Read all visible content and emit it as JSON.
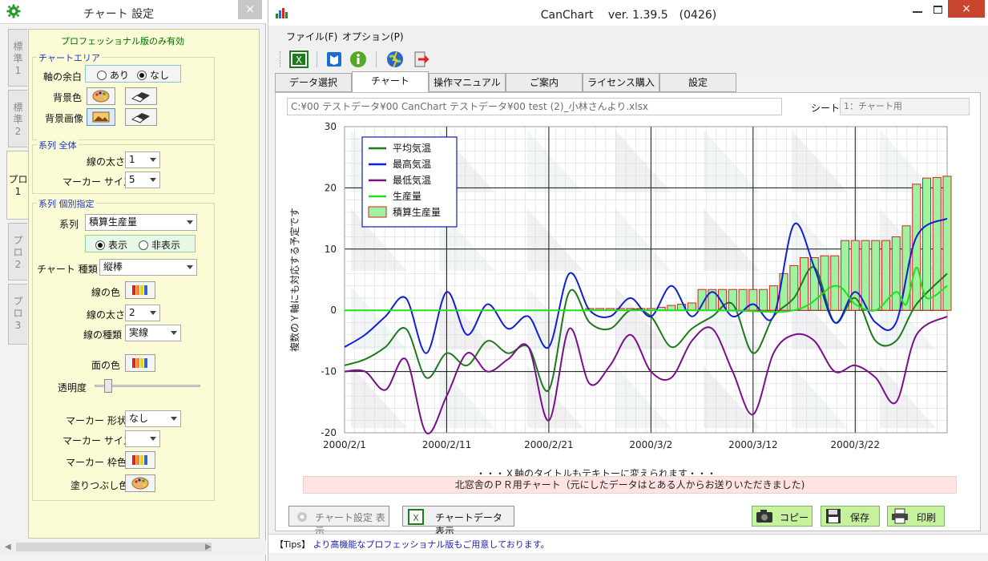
{
  "settings_window": {
    "title": "チャート 設定",
    "close_label": "×",
    "side_tabs": [
      {
        "label": "標準\n1"
      },
      {
        "label": "標準\n2"
      },
      {
        "label": "プロ\n1"
      },
      {
        "label": "プロ\n2"
      },
      {
        "label": "プロ\n3"
      }
    ],
    "active_tab": "プロ\n1",
    "pro_note": "プロフェッショナル版のみ有効",
    "chart_area": {
      "title": "チャートエリア",
      "margin_label": "軸の余白",
      "margin_options": [
        "あり",
        "なし"
      ],
      "margin_selected": "なし",
      "bg_color_label": "背景色",
      "bg_image_label": "背景画像"
    },
    "series_all": {
      "title": "系列 全体",
      "line_width_label": "線の太さ",
      "line_width_value": "1",
      "marker_size_label": "マーカー サイズ",
      "marker_size_value": "5"
    },
    "series_each": {
      "title": "系列 個別指定",
      "series_label": "系列",
      "series_value": "積算生産量",
      "visibility_options": [
        "表示",
        "非表示"
      ],
      "visibility_selected": "表示",
      "chart_type_label": "チャート 種類",
      "chart_type_value": "縦棒",
      "line_color_label": "線の色",
      "line_width_label": "線の太さ",
      "line_width_value": "2",
      "line_style_label": "線の種類",
      "line_style_value": "実線",
      "fill_color_label": "面の色",
      "opacity_label": "透明度",
      "opacity_value": 0.1,
      "marker_shape_label": "マーカー 形状",
      "marker_shape_value": "なし",
      "marker_size_label": "マーカー サイズ",
      "marker_size_value": "",
      "marker_border_label": "マーカー 枠色",
      "fill_label": "塗りつぶし色"
    }
  },
  "main_window": {
    "title": "CanChart　 ver. 1.39.5　(0426)",
    "close_label": "×",
    "menu": [
      "ファイル(F)",
      "オプション(P)"
    ],
    "toolbar_icons": [
      "excel-icon",
      "manual-book-icon",
      "info-icon",
      "update-globe-icon",
      "exit-icon"
    ],
    "tabs": [
      "データ選択",
      "チャート",
      "操作マニュアル",
      "ご案内",
      "ライセンス購入",
      "設定"
    ],
    "active_tab": "チャート",
    "file_path": "C:¥00 テストデータ¥00 CanChart テストデータ¥00 test (2)_小林さんより.xlsx",
    "sheet_label": "シート",
    "sheet_value": "1：チャート用",
    "x_title": "・・・Ｘ軸のタイトルもテキトーに変えられます・・・",
    "sub_caption": "北窓舎のＰＲ用チャート（元にしたデータはとある人からお送りいただきました)",
    "buttons": {
      "chart_settings": "チャート設定 表示",
      "chart_data": "チャートデータ 表示",
      "copy": "コピー",
      "save": "保存",
      "print": "印刷"
    },
    "status": {
      "tag": "【Tips】",
      "text": "より高機能なプロフェッショナル版もご用意しております。"
    }
  },
  "colors": {
    "avg": "#1c7a1c",
    "max": "#1020d0",
    "min": "#7a0f8a",
    "prod": "#22dd22",
    "bar_fill": "#9ff29f",
    "bar_stroke": "#d42020"
  },
  "chart_data": {
    "type": "line",
    "ylabel": "複数のＹ軸にも対応する予定です",
    "xlabel": "・・・Ｘ軸のタイトルもテキトーに変えられます・・・",
    "ylim": [
      -20,
      30
    ],
    "yticks": [
      30,
      20,
      10,
      0,
      -10,
      -20
    ],
    "x_tick_labels": [
      "2000/2/1",
      "2000/2/11",
      "2000/2/21",
      "2000/3/2",
      "2000/3/12",
      "2000/3/22"
    ],
    "x_start": "2000/2/1",
    "x_end": "2000/3/31",
    "grid": true,
    "legend_position": "top-left",
    "series": [
      {
        "name": "平均気温",
        "type": "line",
        "x": [
          "2000/2/1",
          "2000/2/3",
          "2000/2/5",
          "2000/2/7",
          "2000/2/9",
          "2000/2/11",
          "2000/2/13",
          "2000/2/15",
          "2000/2/17",
          "2000/2/19",
          "2000/2/21",
          "2000/2/23",
          "2000/2/25",
          "2000/2/27",
          "2000/2/29",
          "2000/3/2",
          "2000/3/4",
          "2000/3/6",
          "2000/3/8",
          "2000/3/10",
          "2000/3/12",
          "2000/3/14",
          "2000/3/16",
          "2000/3/18",
          "2000/3/20",
          "2000/3/22",
          "2000/3/24",
          "2000/3/26",
          "2000/3/28",
          "2000/3/31"
        ],
        "y": [
          -9,
          -8,
          -6,
          -3,
          -11,
          -7,
          -9,
          -5,
          -7,
          -6,
          -13,
          3,
          -2,
          -3,
          0,
          -1,
          -6,
          -3,
          -1,
          1,
          -7,
          -1,
          2,
          7,
          -2,
          2,
          -5,
          -5,
          1,
          6
        ]
      },
      {
        "name": "最高気温",
        "type": "line",
        "x": [
          "2000/2/1",
          "2000/2/3",
          "2000/2/5",
          "2000/2/7",
          "2000/2/9",
          "2000/2/11",
          "2000/2/13",
          "2000/2/15",
          "2000/2/17",
          "2000/2/19",
          "2000/2/21",
          "2000/2/23",
          "2000/2/25",
          "2000/2/27",
          "2000/2/29",
          "2000/3/2",
          "2000/3/4",
          "2000/3/6",
          "2000/3/8",
          "2000/3/10",
          "2000/3/12",
          "2000/3/14",
          "2000/3/16",
          "2000/3/18",
          "2000/3/20",
          "2000/3/22",
          "2000/3/24",
          "2000/3/26",
          "2000/3/28",
          "2000/3/31"
        ],
        "y": [
          -6,
          -4,
          -1,
          2,
          -7,
          3,
          -4,
          1,
          -3,
          -1,
          -6,
          6,
          0,
          -1,
          2,
          -1,
          4,
          -1,
          3,
          -1,
          1,
          -1,
          14,
          7,
          -2,
          3,
          -2,
          -2,
          12,
          15
        ]
      },
      {
        "name": "最低気温",
        "type": "line",
        "x": [
          "2000/2/1",
          "2000/2/3",
          "2000/2/5",
          "2000/2/7",
          "2000/2/9",
          "2000/2/11",
          "2000/2/13",
          "2000/2/15",
          "2000/2/17",
          "2000/2/19",
          "2000/2/21",
          "2000/2/23",
          "2000/2/25",
          "2000/2/27",
          "2000/2/29",
          "2000/3/2",
          "2000/3/4",
          "2000/3/6",
          "2000/3/8",
          "2000/3/10",
          "2000/3/12",
          "2000/3/14",
          "2000/3/16",
          "2000/3/18",
          "2000/3/20",
          "2000/3/22",
          "2000/3/24",
          "2000/3/26",
          "2000/3/28",
          "2000/3/31"
        ],
        "y": [
          -10,
          -10,
          -13,
          -8,
          -20,
          -14,
          -7,
          -10,
          -8,
          -6,
          -18,
          -3,
          -12,
          -9,
          -4,
          -10,
          -11,
          -5,
          -3,
          -10,
          -17,
          -7,
          -4,
          -5,
          -10,
          -9,
          -11,
          -15,
          -4,
          -1
        ]
      },
      {
        "name": "生産量",
        "type": "line",
        "x": [
          "2000/2/1",
          "2000/3/7",
          "2000/3/16",
          "2000/3/20",
          "2000/3/22",
          "2000/3/24",
          "2000/3/26",
          "2000/3/27",
          "2000/3/28",
          "2000/3/29",
          "2000/3/31"
        ],
        "y": [
          0,
          0,
          0,
          4,
          1,
          0,
          3,
          1,
          7,
          2,
          4
        ]
      },
      {
        "name": "積算生産量",
        "type": "bar",
        "x": [
          "2000/2/25",
          "2000/2/26",
          "2000/2/27",
          "2000/2/28",
          "2000/2/29",
          "2000/3/1",
          "2000/3/2",
          "2000/3/3",
          "2000/3/4",
          "2000/3/5",
          "2000/3/6",
          "2000/3/7",
          "2000/3/8",
          "2000/3/9",
          "2000/3/10",
          "2000/3/11",
          "2000/3/12",
          "2000/3/13",
          "2000/3/14",
          "2000/3/15",
          "2000/3/16",
          "2000/3/17",
          "2000/3/18",
          "2000/3/19",
          "2000/3/20",
          "2000/3/21",
          "2000/3/22",
          "2000/3/23",
          "2000/3/24",
          "2000/3/25",
          "2000/3/26",
          "2000/3/27",
          "2000/3/28",
          "2000/3/29",
          "2000/3/30",
          "2000/3/31"
        ],
        "y": [
          0.3,
          0.3,
          0.3,
          0.3,
          0.3,
          0.3,
          0.3,
          0.5,
          0.8,
          1.0,
          1.2,
          3.4,
          3.4,
          3.4,
          3.4,
          3.4,
          3.4,
          3.4,
          4.0,
          6.0,
          7.3,
          8.6,
          8.6,
          8.9,
          8.9,
          11.4,
          11.4,
          11.4,
          11.4,
          11.4,
          12.0,
          13.8,
          20.6,
          21.6,
          21.7,
          21.9
        ]
      }
    ]
  }
}
